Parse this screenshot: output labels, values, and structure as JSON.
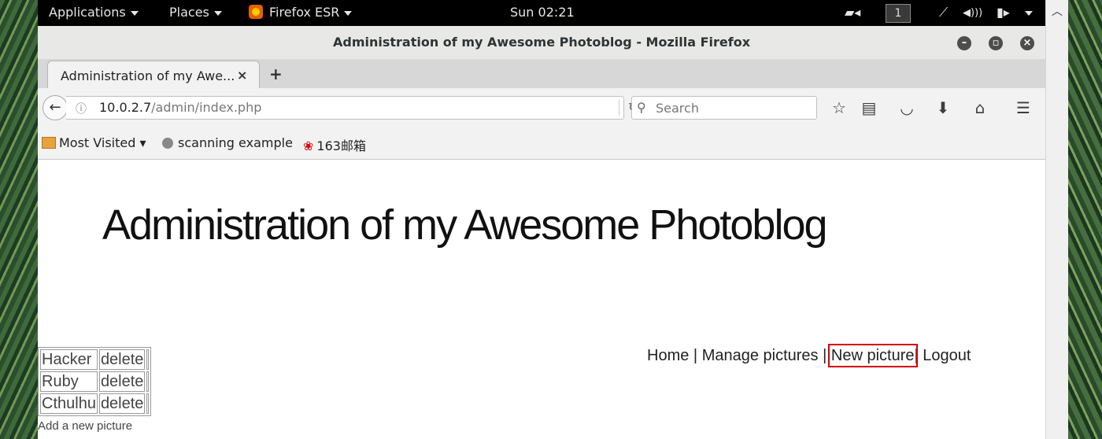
{
  "desktop": {
    "panel": {
      "applications": "Applications",
      "places": "Places",
      "active_app": "Firefox ESR",
      "clock": "Sun 02:21",
      "workspace": "1"
    }
  },
  "window": {
    "title": "Administration of my Awesome Photoblog - Mozilla Firefox"
  },
  "tabs": [
    {
      "label": "Administration of my Awe..."
    }
  ],
  "navbar": {
    "url_host": "10.0.2.7",
    "url_path": "/admin/index.php",
    "search_placeholder": "Search"
  },
  "bookmarks": [
    {
      "label": "Most Visited ▾"
    },
    {
      "label": "scanning example"
    },
    {
      "label": "163邮箱"
    }
  ],
  "page": {
    "title": "Administration of my Awesome Photoblog",
    "nav": {
      "home": "Home",
      "manage": "Manage pictures",
      "new": "New picture",
      "logout": "Logout",
      "sep": "|"
    },
    "pictures": [
      {
        "name": "Hacker",
        "action": "delete"
      },
      {
        "name": "Ruby",
        "action": "delete"
      },
      {
        "name": "Cthulhu",
        "action": "delete"
      }
    ],
    "add_link": "Add a new picture"
  },
  "colors": {
    "highlight_box": "#d40000",
    "firefox_logo": "#e66000"
  }
}
